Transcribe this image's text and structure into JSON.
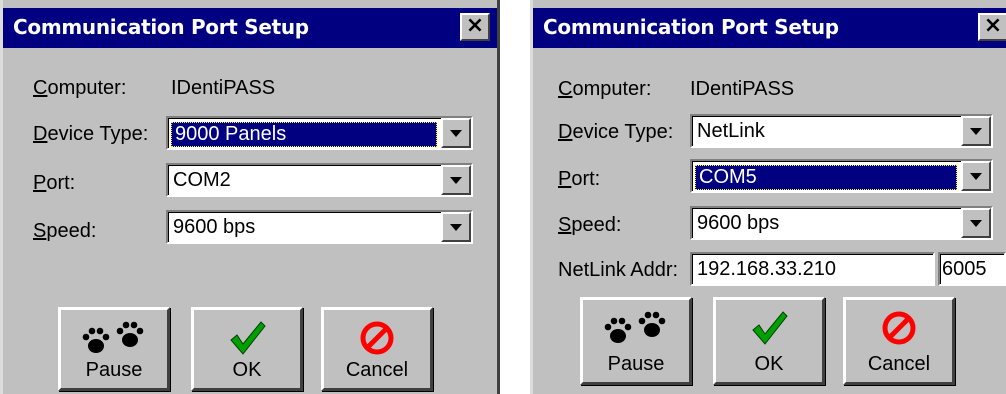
{
  "dialogs": [
    {
      "title": "Communication Port Setup",
      "close_glyph": "×",
      "computer_label": "Computer:",
      "computer_value": "IDentiPASS",
      "device_type_label": "Device Type:",
      "device_type_value": "9000 Panels",
      "port_label": "Port:",
      "port_value": "COM2",
      "speed_label": "Speed:",
      "speed_value": "9600 bps",
      "buttons": {
        "pause": "Pause",
        "ok": "OK",
        "cancel": "Cancel"
      }
    },
    {
      "title": "Communication Port Setup",
      "close_glyph": "×",
      "computer_label": "Computer:",
      "computer_value": "IDentiPASS",
      "device_type_label": "Device Type:",
      "device_type_value": "NetLink",
      "port_label": "Port:",
      "port_value": "COM5",
      "speed_label": "Speed:",
      "speed_value": "9600 bps",
      "netlink_label": "NetLink Addr:",
      "netlink_ip": "192.168.33.210",
      "netlink_port": "6005",
      "buttons": {
        "pause": "Pause",
        "ok": "OK",
        "cancel": "Cancel"
      }
    }
  ],
  "icons": {
    "pause": "paw-prints-icon",
    "ok": "checkmark-icon",
    "cancel": "no-symbol-icon"
  },
  "colors": {
    "titlebar": "#000080",
    "face": "#c0c0c0",
    "selection": "#000080",
    "ok_green": "#00a000",
    "cancel_red": "#ff0000"
  }
}
